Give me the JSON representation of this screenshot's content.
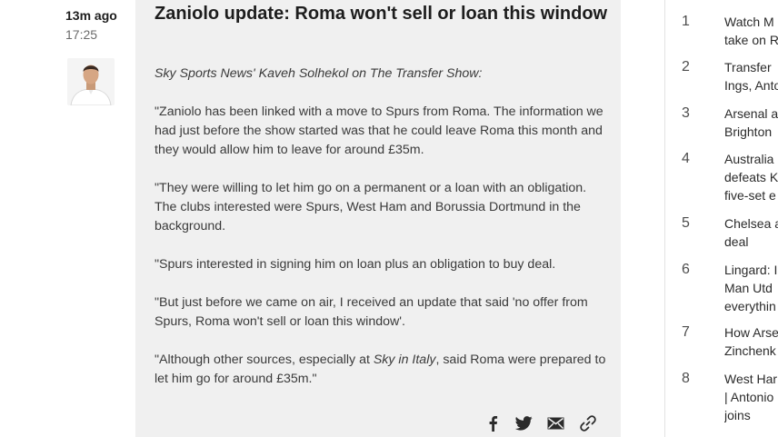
{
  "post": {
    "time_ago": "13m ago",
    "time": "17:25",
    "title": "Zaniolo update: Roma won't sell or loan this window",
    "source_line": "Sky Sports News' Kaveh Solhekol on The Transfer Show:",
    "para1": "\"Zaniolo has been linked with a move to Spurs from Roma. The information we had just before the show started was that he could leave Roma this month and they would allow him to leave for around £35m.",
    "para2": "\"They were willing to let him go on a permanent or a loan with an obligation. The clubs interested were Spurs, West Ham and Borussia Dortmund in the background.",
    "para3": "\"Spurs interested in signing him on loan plus an obligation to buy deal.",
    "para4": "\"But just before we came on air, I received an update that said 'no offer from Spurs, Roma won't sell or loan this window'.",
    "para5_a": "\"Although other sources, especially at ",
    "para5_em": "Sky in Italy",
    "para5_b": ", said Roma were prepared to let him go for around £35m.\""
  },
  "share": {
    "facebook_icon": "facebook-icon",
    "twitter_icon": "twitter-icon",
    "email_icon": "email-icon",
    "link_icon": "link-icon"
  },
  "rail": {
    "items": [
      {
        "num": "1",
        "text": "Watch M\ntake on R"
      },
      {
        "num": "2",
        "text": "Transfer\nIngs, Anto"
      },
      {
        "num": "3",
        "text": "Arsenal a\nBrighton"
      },
      {
        "num": "4",
        "text": "Australia\ndefeats K\nfive-set e"
      },
      {
        "num": "5",
        "text": "Chelsea a\ndeal"
      },
      {
        "num": "6",
        "text": "Lingard: I\nMan Utd\neverythin"
      },
      {
        "num": "7",
        "text": "How Arse\nZinchenk"
      },
      {
        "num": "8",
        "text": "West Har\n| Antonio\njoins"
      }
    ]
  }
}
